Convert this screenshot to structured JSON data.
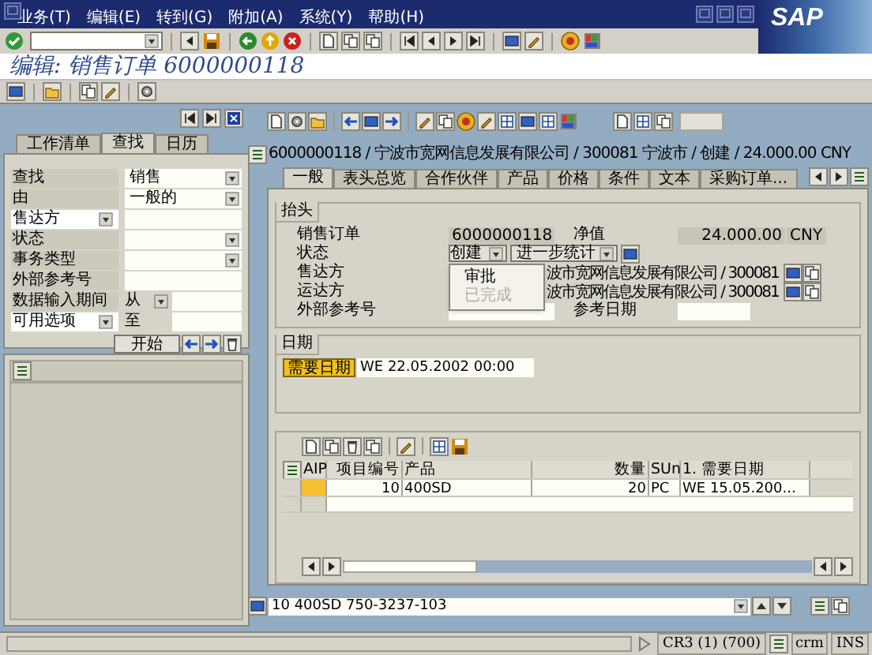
{
  "menu_bar": {
    "items": [
      "业务(T)",
      "编辑(E)",
      "转到(G)",
      "附加(A)",
      "系统(Y)",
      "帮助(H)"
    ],
    "logo": "SAP"
  },
  "title": "编辑: 销售订单 6000000118",
  "locator": {
    "tabs": [
      {
        "label": "工作清单",
        "selected": false
      },
      {
        "label": "查找",
        "selected": true
      },
      {
        "label": "日历",
        "selected": false
      }
    ],
    "rows": [
      {
        "label": "查找",
        "value": "销售",
        "dropdown": true,
        "label_help": false
      },
      {
        "label": "由",
        "value": "一般的",
        "dropdown": true,
        "label_help": false
      },
      {
        "label": "售达方",
        "dropdown": false,
        "label_help": true
      },
      {
        "label": "状态",
        "dropdown": true,
        "label_help": false
      },
      {
        "label": "事务类型",
        "dropdown": true,
        "label_help": false
      },
      {
        "label": "外部参考号",
        "dropdown": false,
        "label_help": false
      },
      {
        "label": "数据输入期间",
        "label_help": false,
        "prefix": "从",
        "prefix_select": true
      },
      {
        "label": "可用选项",
        "label_help": true,
        "prefix": "至",
        "prefix_select": false
      }
    ],
    "start_button": "开始"
  },
  "order": {
    "header": "6000000118 / 宁波市宽网信息发展有限公司 / 300081 宁波市 / 创建 / 24.000.00 CNY",
    "tabs": [
      {
        "label": "一般",
        "selected": true
      },
      {
        "label": "表头总览",
        "selected": false
      },
      {
        "label": "合作伙伴",
        "selected": false
      },
      {
        "label": "产品",
        "selected": false
      },
      {
        "label": "价格",
        "selected": false
      },
      {
        "label": "条件",
        "selected": false
      },
      {
        "label": "文本",
        "selected": false
      },
      {
        "label": "采购订单...",
        "selected": false
      }
    ],
    "header_group": {
      "title": "抬头",
      "sales_order_label": "销售订单",
      "sales_order": "6000000118",
      "net_value_label": "净值",
      "net_value": "24.000.00",
      "currency": "CNY",
      "status_label": "状态",
      "status_button": "创建",
      "further_button": "进一步统计",
      "sold_to_label": "售达方",
      "sold_to": "波市宽网信息发展有限公司 / 300081",
      "ship_to_label": "运达方",
      "ship_to": "波市宽网信息发展有限公司 / 300081",
      "ext_ref_label": "外部参考号",
      "ref_date_label": "参考日期",
      "status_menu": [
        {
          "label": "审批",
          "disabled": false
        },
        {
          "label": "已完成",
          "disabled": true
        }
      ]
    },
    "dates_group": {
      "title": "日期",
      "label": "需要日期",
      "value": "WE 22.05.2002 00:00"
    },
    "items_table": {
      "columns": [
        "AIP",
        "项目编号",
        "产品",
        "数量",
        "SUn",
        "1. 需要日期"
      ],
      "rows": [
        {
          "aip_flag": true,
          "cells": [
            "",
            "10",
            "400SD",
            "20",
            "PC",
            "WE 15.05.200..."
          ]
        }
      ]
    },
    "item_field": "10 400SD 750-3237-103"
  },
  "status_bar": {
    "system": "CR3 (1) (700)",
    "client": "crm",
    "mode": "INS"
  }
}
